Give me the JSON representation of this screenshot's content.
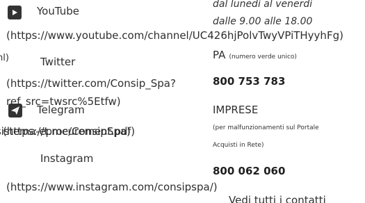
{
  "left": {
    "youtube": {
      "label": "YouTube",
      "url": "(https://www.youtube.com/channel/UC426hjPolvTwyVPiTHyyhFg)",
      "icon": "youtube-icon"
    },
    "cutoff_text_top": "nl)",
    "twitter": {
      "label": "Twitter",
      "url_line1": "(https://twitter.com/Consip_Spa?",
      "url_line2": "ref_src=twsrc%5Etfw)",
      "icon": "twitter-icon"
    },
    "telegram": {
      "label": "Telegram",
      "url": "(https://t.me/ConsipSpa)",
      "icon": "telegram-icon"
    },
    "overlap_text": "sistema-eprocurement.pdf)",
    "instagram": {
      "label": "Instagram",
      "url": "(https://www.instagram.com/consipspa/)",
      "icon": "instagram-icon"
    }
  },
  "right": {
    "hours_line1": "dal lunedì al venerdì",
    "hours_line2": "dalle 9.00 alle 18.00",
    "pa_label": "PA",
    "pa_note": "(numero verde unico)",
    "pa_phone": "800 753 783",
    "imprese_label": "IMPRESE",
    "imprese_note_line1": "(per malfunzionamenti sul Portale",
    "imprese_note_line2": "Acquisti in Rete)",
    "imprese_phone": "800 062 060",
    "all_contacts": "Vedi tutti i contatti"
  },
  "colors": {
    "text": "#2f2f2f",
    "icon_bg": "#333333"
  }
}
